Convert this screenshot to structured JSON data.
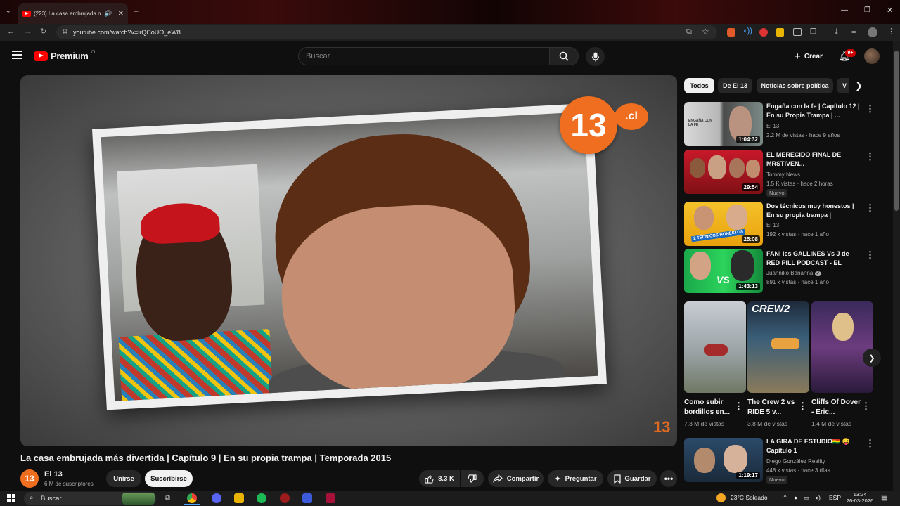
{
  "browser": {
    "tab_title": "(223) La casa embrujada m",
    "url": "youtube.com/watch?v=lrQCoUO_eW8"
  },
  "header": {
    "logo_text": "Premium",
    "country": "CL",
    "search_placeholder": "Buscar",
    "create_label": "Crear",
    "notif_count": "9+"
  },
  "video": {
    "title": "La casa embrujada más divertida | Capítulo 9 | En su propia trampa | Temporada 2015",
    "watermark_13": "13",
    "watermark_cl": ".cl",
    "corner_logo": "13"
  },
  "channel": {
    "avatar_text": "13",
    "name": "El 13",
    "subscribers": "6 M de suscriptores",
    "join_label": "Unirse",
    "subscribe_label": "Suscribirse"
  },
  "actions": {
    "likes": "8.3 K",
    "share": "Compartir",
    "ask": "Preguntar",
    "save": "Guardar"
  },
  "chips": [
    "Todos",
    "De El 13",
    "Noticias sobre política",
    "V"
  ],
  "recommendations": [
    {
      "title": "Engaña con la fe | Capítulo 12 | En su Propia Trampa | ...",
      "channel": "El 13",
      "meta": "2.2 M de vistas · hace 9 años",
      "duration": "1:04:32",
      "thumb_text": "ENGAÑA CON LA FE"
    },
    {
      "title": "EL MERECIDO FINAL DE MRSTIVEN...",
      "channel": "Tommy News",
      "meta": "1.5 K vistas · hace 2 horas",
      "duration": "29:54",
      "badge": "Nuevo"
    },
    {
      "title": "Dos técnicos muy honestos | En su propia trampa | Temporada ...",
      "channel": "El 13",
      "meta": "192 k vistas · hace 1 año",
      "duration": "25:08",
      "thumb_text": "2 TÉCNICOS HONESTOS"
    },
    {
      "title": "FANI les GALLINES Vs J de RED PILL PODCAST - EL GRAN ...",
      "channel": "Juanniko Bananna",
      "meta": "891 k vistas · hace 1 año",
      "duration": "1:43:13",
      "thumb_text": "VS"
    },
    {
      "title": "LA GIRA DE ESTUDIO🇧🇴 😝 Capítulo 1",
      "channel": "Diego González Reality",
      "meta": "448 k vistas · hace 3 días",
      "duration": "1:19:17",
      "badge": "Nuevo"
    }
  ],
  "shorts": [
    {
      "title": "Como subir bordillos en...",
      "views": "7.3 M de vistas"
    },
    {
      "title": "The Crew 2 vs RIDE 5 v...",
      "views": "3.8 M de vistas",
      "thumb_text": "CREW2"
    },
    {
      "title": "Cliffs Of Dover - Eric...",
      "views": "1.4 M de vistas"
    }
  ],
  "taskbar": {
    "search": "Buscar",
    "weather": "23°C  Soleado",
    "lang": "ESP",
    "time": "13:24",
    "date": "26-03-2026"
  }
}
